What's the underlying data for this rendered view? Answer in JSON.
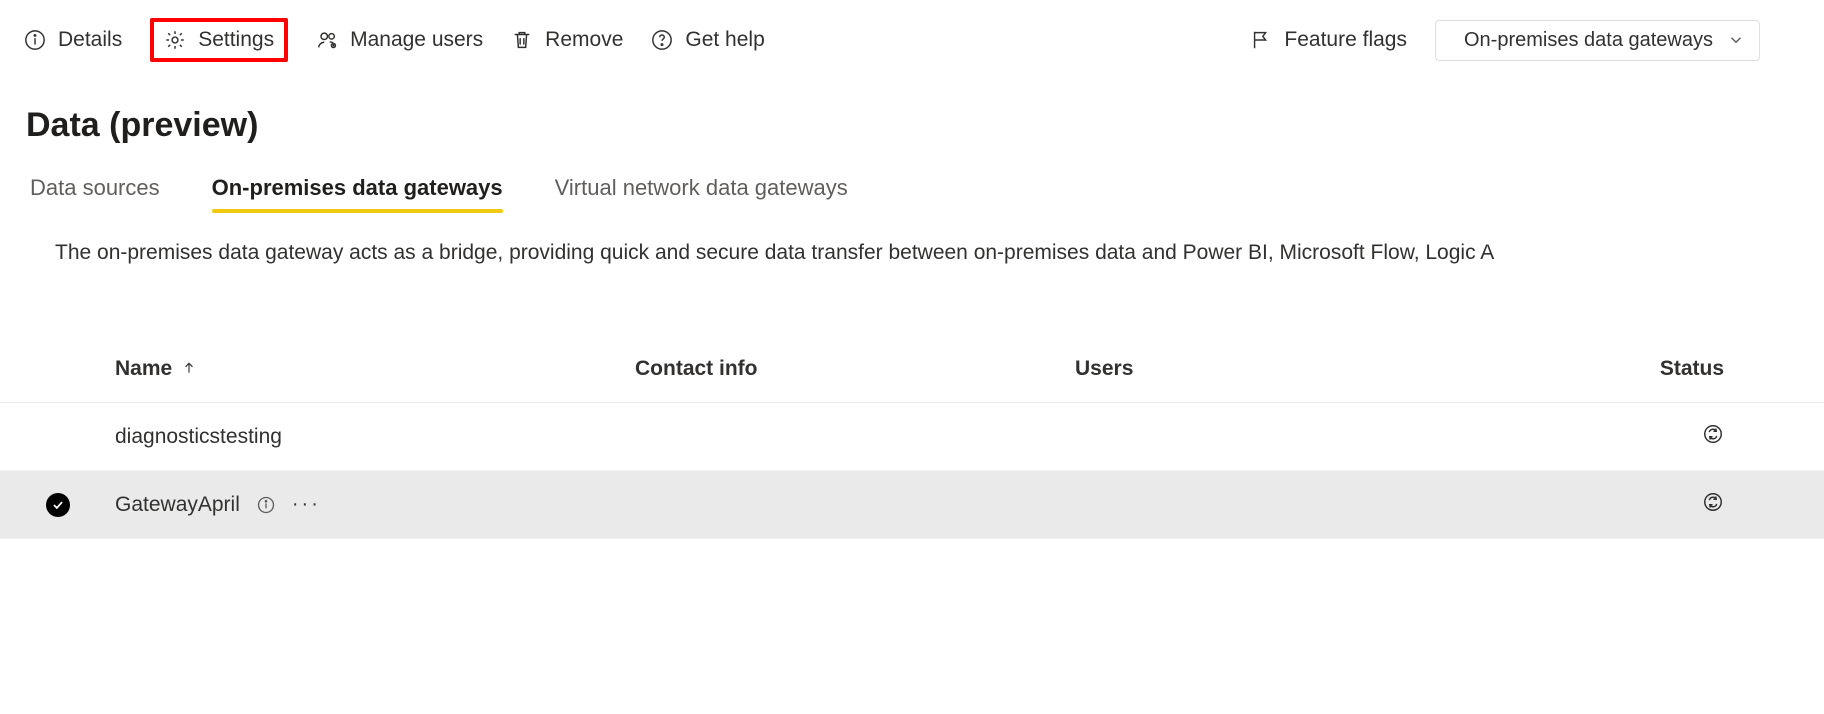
{
  "toolbar": {
    "details": "Details",
    "settings": "Settings",
    "manage_users": "Manage users",
    "remove": "Remove",
    "get_help": "Get help",
    "feature_flags": "Feature flags",
    "view_selector": "On-premises data gateways"
  },
  "page": {
    "title": "Data (preview)"
  },
  "tabs": {
    "data_sources": "Data sources",
    "onprem": "On-premises data gateways",
    "vnet": "Virtual network data gateways"
  },
  "description": "The on-premises data gateway acts as a bridge, providing quick and secure data transfer between on-premises data and Power BI, Microsoft Flow, Logic A",
  "table": {
    "headers": {
      "name": "Name",
      "contact": "Contact info",
      "users": "Users",
      "status": "Status"
    },
    "rows": [
      {
        "name": "diagnosticstesting",
        "selected": false,
        "has_info": false
      },
      {
        "name": "GatewayApril",
        "selected": true,
        "has_info": true
      }
    ]
  }
}
